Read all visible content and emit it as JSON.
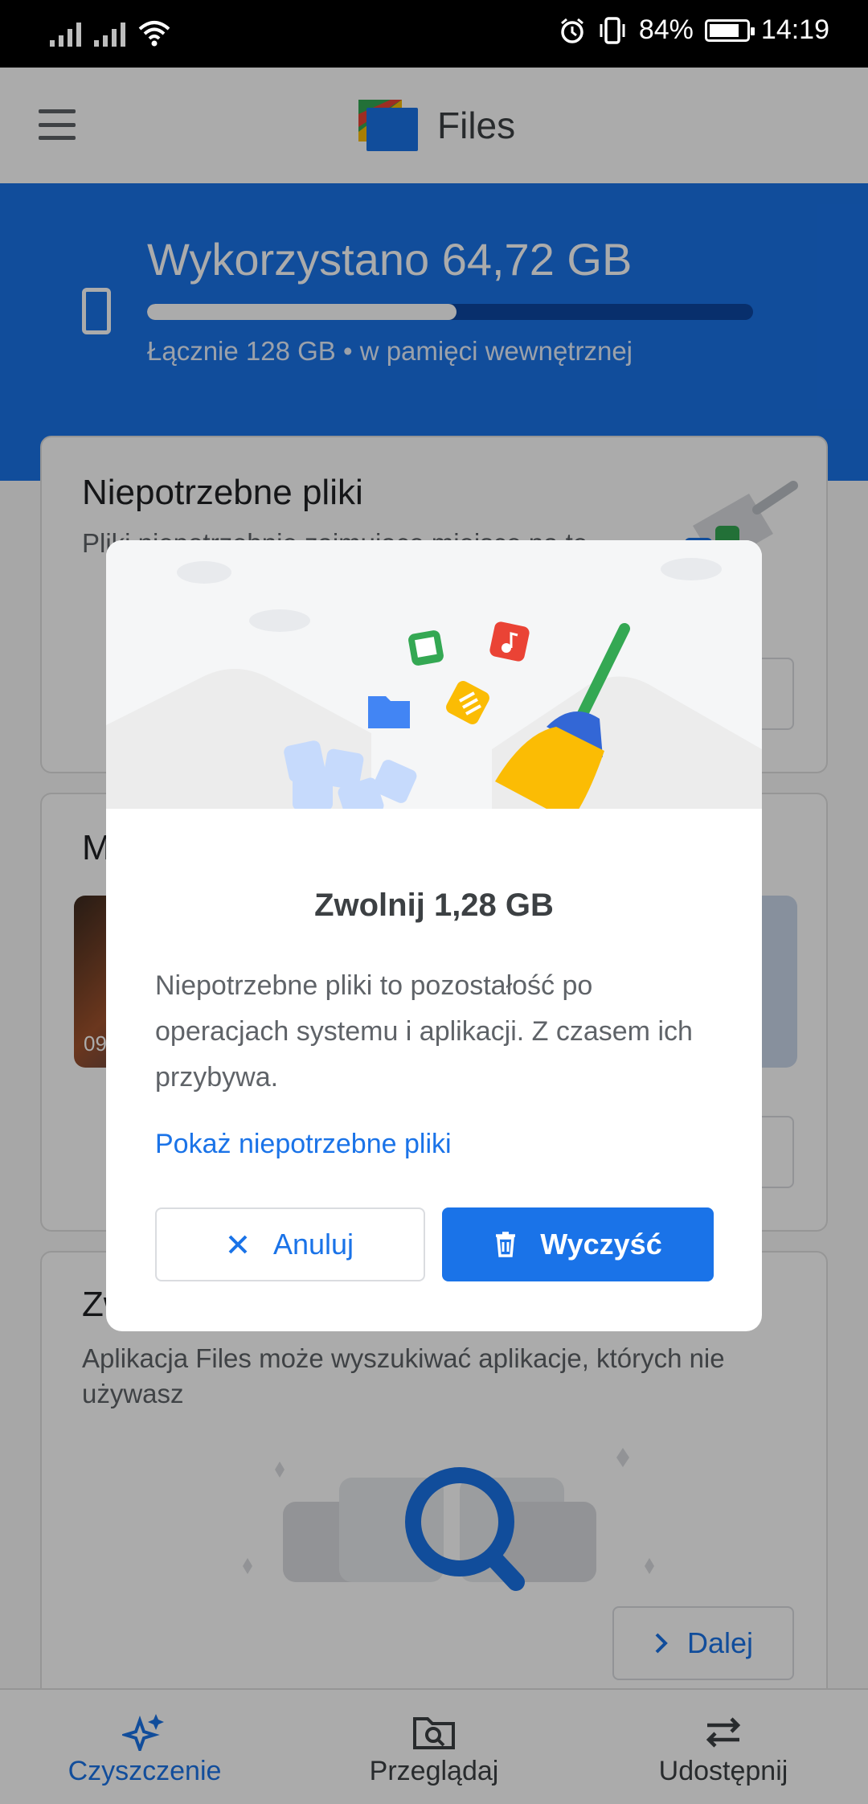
{
  "status_bar": {
    "battery": "84%",
    "time": "14:19",
    "battery_level": 0.84,
    "icons": [
      "signal-icon",
      "signal-icon",
      "wifi-icon",
      "alarm-icon",
      "vibrate-icon",
      "battery-icon"
    ]
  },
  "app_bar": {
    "title": "Files",
    "icons": [
      "menu-icon",
      "files-logo"
    ]
  },
  "storage": {
    "title": "Wykorzystano 64,72 GB",
    "subtitle": "Łącznie 128 GB • w pamięci wewnętrznej",
    "used_fraction": 0.51,
    "icon": "phone-icon"
  },
  "cards": {
    "junk": {
      "title": "Niepotrzebne pliki",
      "desc": "Pliki niepotrzebnie zajmujące miejsce na te"
    },
    "media": {
      "title": "M",
      "thumb_label": "09"
    },
    "apps": {
      "title": "Zw",
      "desc": "Aplikacja Files może wyszukiwać aplikacje, których nie używasz",
      "button": "Dalej"
    }
  },
  "bottom_nav": {
    "items": [
      {
        "label": "Czyszczenie",
        "icon": "sparkle-icon",
        "active": true
      },
      {
        "label": "Przeglądaj",
        "icon": "browse-folder-icon",
        "active": false
      },
      {
        "label": "Udostępnij",
        "icon": "swap-arrows-icon",
        "active": false
      }
    ]
  },
  "dialog": {
    "title": "Zwolnij 1,28 GB",
    "body": "Niepotrzebne pliki to pozostałość po operacjach systemu i aplikacji. Z czasem ich przybywa.",
    "link": "Pokaż niepotrzebne pliki",
    "cancel_label": "Anuluj",
    "confirm_label": "Wyczyść",
    "illustration": "broom-cleaning-illustration"
  },
  "colors": {
    "primary": "#1a73e8",
    "status_bar": "#000000",
    "broom_head": "#fbbc04",
    "broom_handle": "#34a853"
  }
}
